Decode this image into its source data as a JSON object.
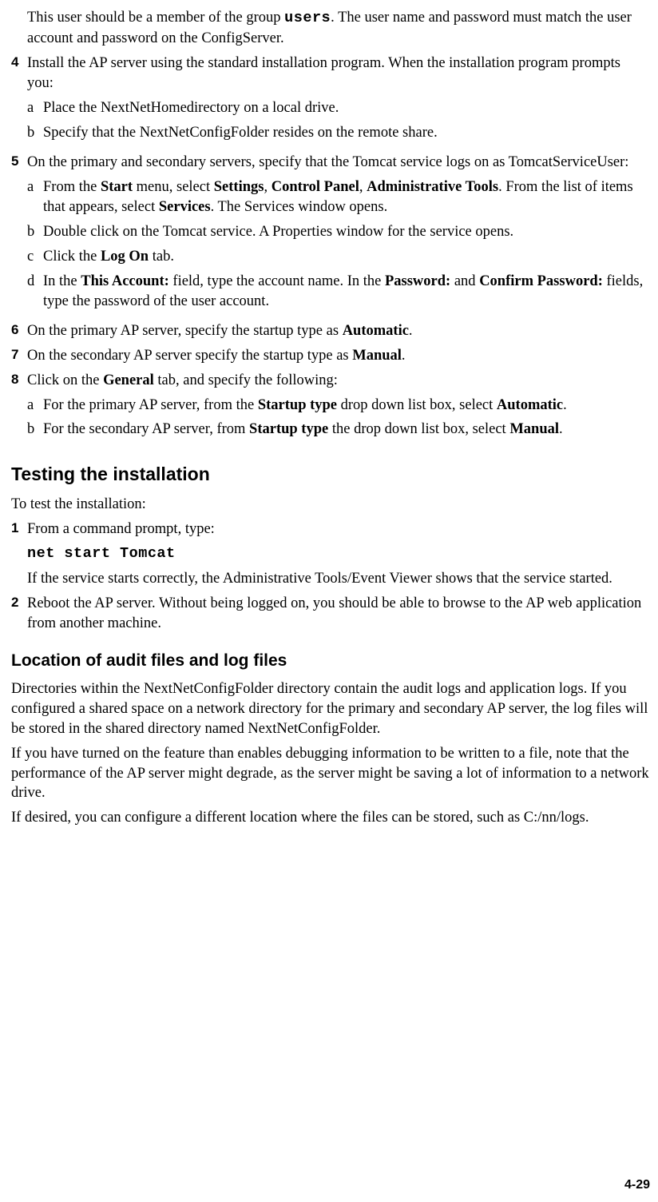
{
  "topPara": {
    "pre": "This user should be a member of the group ",
    "code": "users",
    "post": ". The user name and password must match the user account and password on the ConfigServer."
  },
  "step4": {
    "intro": "Install the AP server using the standard installation program. When the installation program prompts you:",
    "a": "Place the NextNetHomedirectory on a local drive.",
    "b": "Specify that the NextNetConfigFolder resides on the remote share."
  },
  "step5": {
    "intro": "On the primary and secondary servers, specify that the Tomcat service logs on as TomcatServiceUser:",
    "a": {
      "t0": "From the ",
      "b0": "Start",
      "t1": " menu, select ",
      "b1": "Settings",
      "t2": ", ",
      "b2": "Control Panel",
      "t3": ", ",
      "b3": "Administrative Tools",
      "t4": ". From the list of items that appears, select ",
      "b4": "Services",
      "t5": ". The Services window opens."
    },
    "b": "Double click on the Tomcat service. A Properties window for the service opens.",
    "c": {
      "t0": "Click the ",
      "b0": "Log On",
      "t1": " tab."
    },
    "d": {
      "t0": "In the ",
      "b0": "This Account:",
      "t1": " field, type the account name. In the ",
      "b1": "Password:",
      "t2": " and ",
      "b2": "Confirm Password:",
      "t3": " fields, type the password of the user account."
    }
  },
  "step6": {
    "t0": "On the primary AP server, specify the startup type as ",
    "b0": "Automatic",
    "t1": "."
  },
  "step7": {
    "t0": "On the secondary AP server specify the startup type as ",
    "b0": "Manual",
    "t1": "."
  },
  "step8": {
    "intro": {
      "t0": "Click on the ",
      "b0": "General",
      "t1": " tab, and specify the following:"
    },
    "a": {
      "t0": "For the primary AP server, from the ",
      "b0": "Startup type",
      "t1": " drop down list box, select ",
      "b1": "Automatic",
      "t2": "."
    },
    "b": {
      "t0": "For the secondary AP server, from ",
      "b0": "Startup type",
      "t1": " the drop down list box, select ",
      "b1": "Manual",
      "t2": "."
    }
  },
  "h2_testing": "Testing the installation",
  "testing_intro": "To test the installation:",
  "t1": {
    "intro": "From a command prompt, type:",
    "cmd": "net start Tomcat",
    "after": "If the service starts correctly, the Administrative Tools/Event Viewer shows that the service started."
  },
  "t2": "Reboot the AP server. Without being logged on, you should be able to browse to the AP web application from another machine.",
  "h3_location": "Location of audit files and log files",
  "loc_p1": "Directories within the NextNetConfigFolder directory contain the audit logs and application logs. If you configured a shared space on a network directory for the primary and secondary AP server, the log files will be stored in the shared directory named NextNetConfigFolder.",
  "loc_p2": "If you have turned on the feature than enables debugging information to be written to a file, note that the performance of the AP server might degrade, as the server might be saving a lot of information to a network drive.",
  "loc_p3": "If desired, you can configure a different location where the files can be stored, such as C:/nn/logs.",
  "pageNumber": "4-29",
  "markers": {
    "m4": "4",
    "m5": "5",
    "m6": "6",
    "m7": "7",
    "m8": "8",
    "m1": "1",
    "m2": "2",
    "a": "a",
    "b": "b",
    "c": "c",
    "d": "d"
  }
}
